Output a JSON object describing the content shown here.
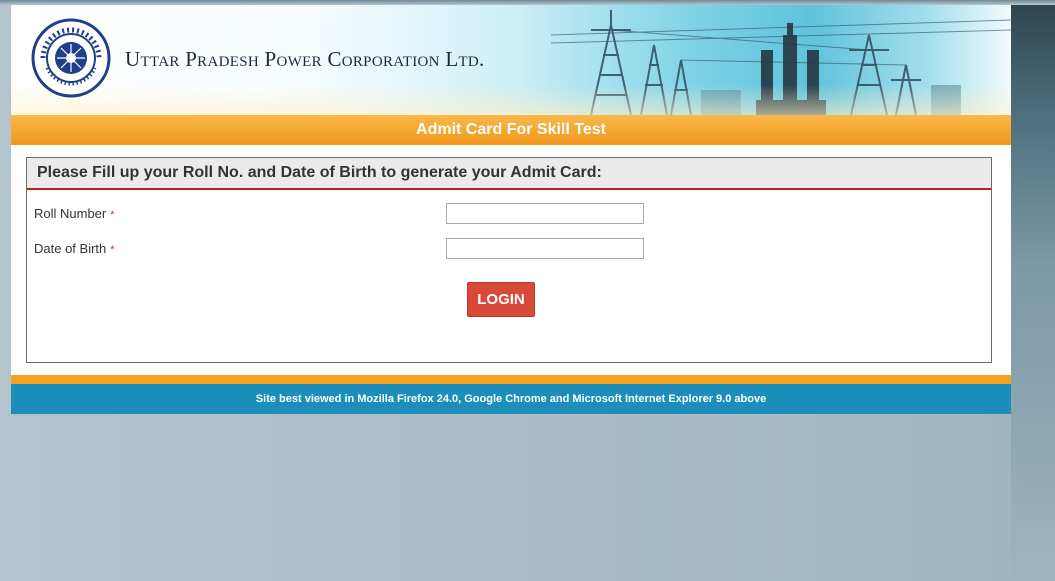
{
  "header": {
    "org_name_first": "U",
    "org_name_rest": "ttar ",
    "org_word2_first": "P",
    "org_word2_rest": "radesh ",
    "org_word3_first": "P",
    "org_word3_rest": "ower ",
    "org_word4_first": "C",
    "org_word4_rest": "orporation ",
    "org_word5": "Ltd.",
    "logo_icon": "uppcl-emblem-icon"
  },
  "titlebar": {
    "title": "Admit Card For Skill Test"
  },
  "form": {
    "heading": "Please Fill up your Roll No. and Date of Birth to generate your Admit Card:",
    "roll_label": "Roll Number",
    "dob_label": "Date of Birth",
    "required_mark": "*",
    "roll_value": "",
    "dob_value": "",
    "login_label": "LOGIN"
  },
  "footer": {
    "text": "Site best viewed in Mozilla Firefox 24.0, Google Chrome and Microsoft Internet Explorer 9.0 above"
  },
  "colors": {
    "orange": "#f2961c",
    "blue": "#1b8fba",
    "button": "#d9493a",
    "divider": "#b12121"
  }
}
